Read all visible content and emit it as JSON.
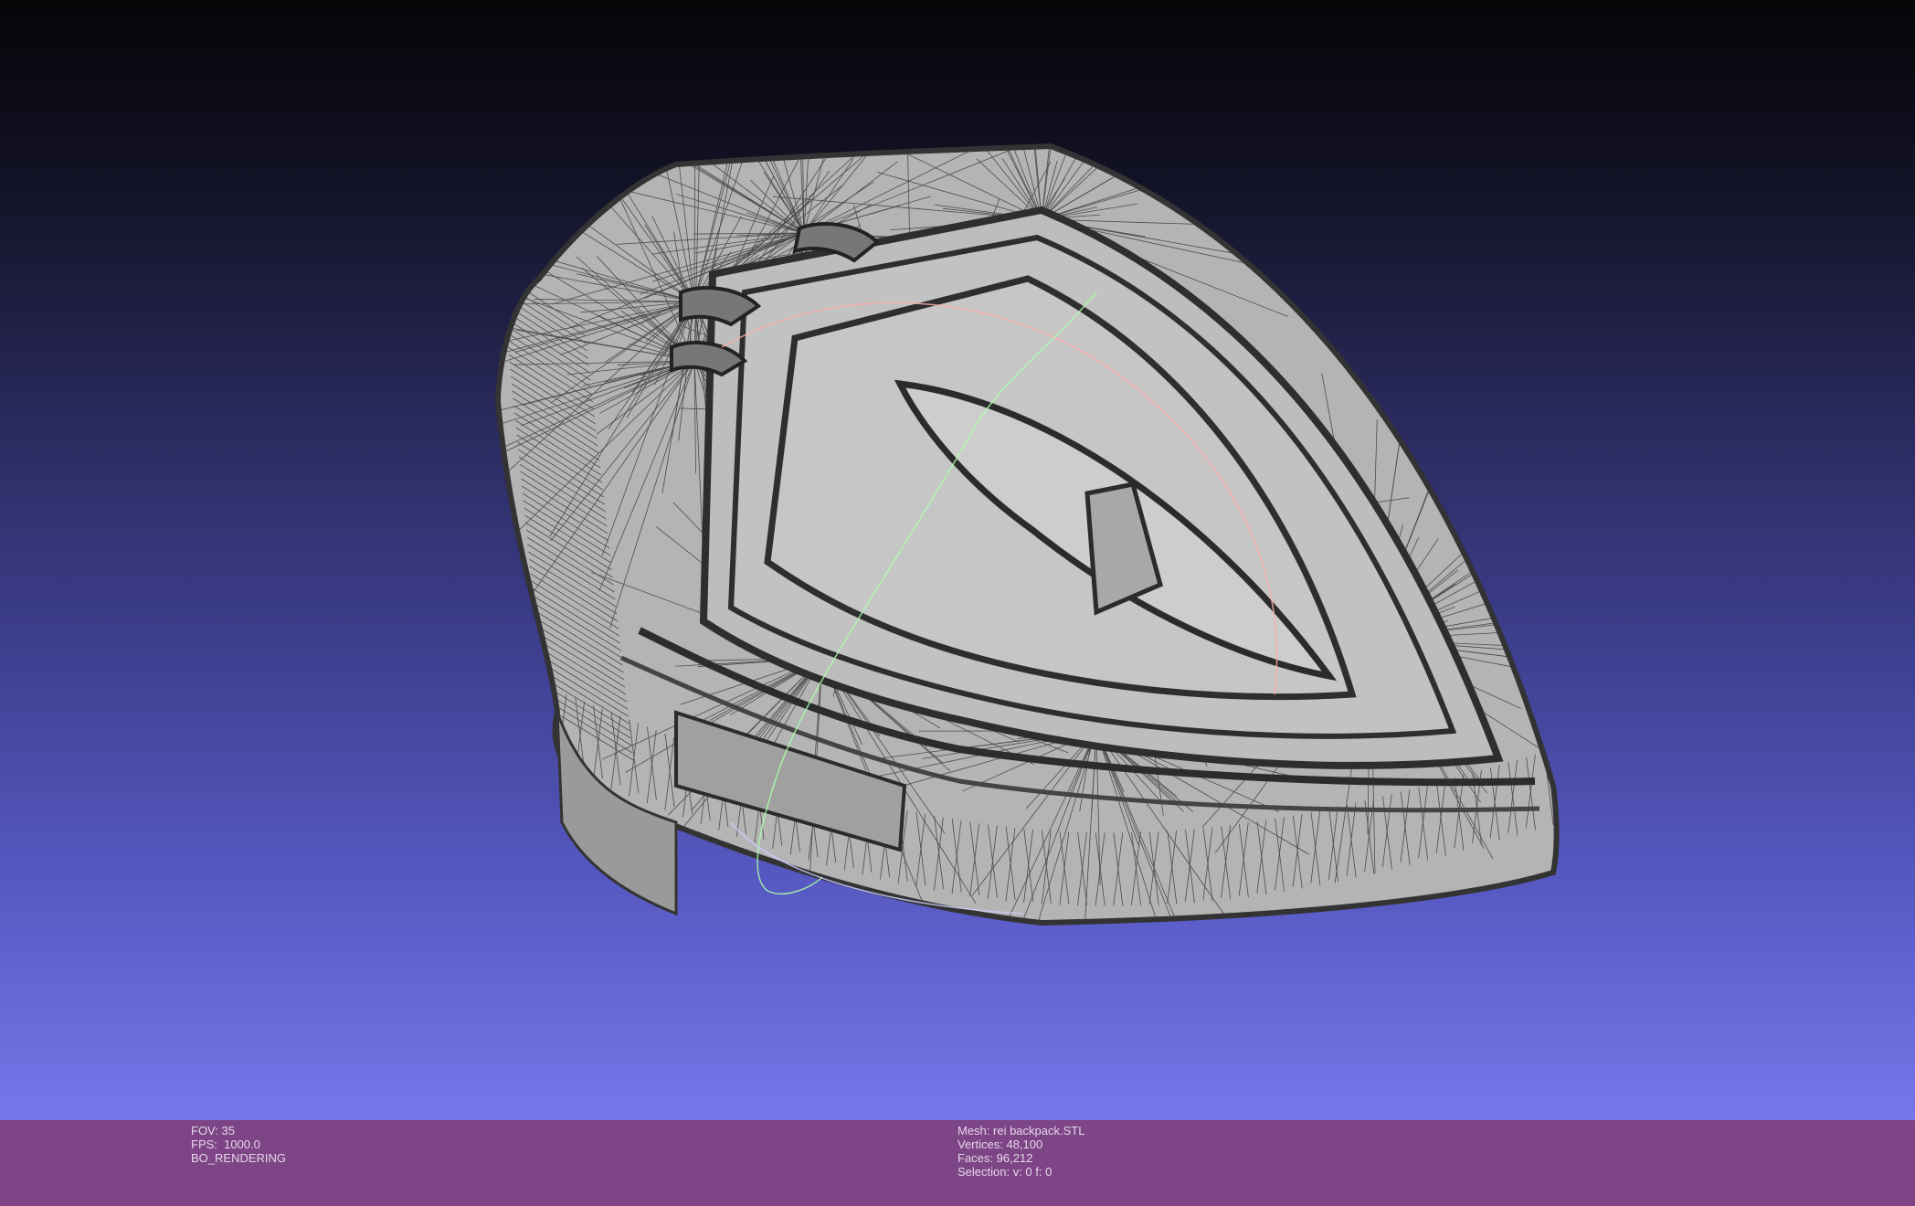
{
  "viewer": {
    "background_top": "#050508",
    "background_bottom": "#7677ea",
    "mesh_color": "#b4b4b4",
    "wire_color": "#3a3a3a",
    "trackball_colors": {
      "x": "#ffaaaa",
      "y": "#aaffaa",
      "z": "#aaaaff"
    }
  },
  "status_bar": {
    "color": "#7d4585",
    "left": {
      "fov": "FOV: 35",
      "fps": "FPS:  1000.0",
      "mode": "BO_RENDERING"
    },
    "right": {
      "mesh": "Mesh: rei backpack.STL",
      "vertices": "Vertices: 48,100",
      "faces": "Faces: 96,212",
      "selection": "Selection: v: 0 f: 0"
    }
  }
}
